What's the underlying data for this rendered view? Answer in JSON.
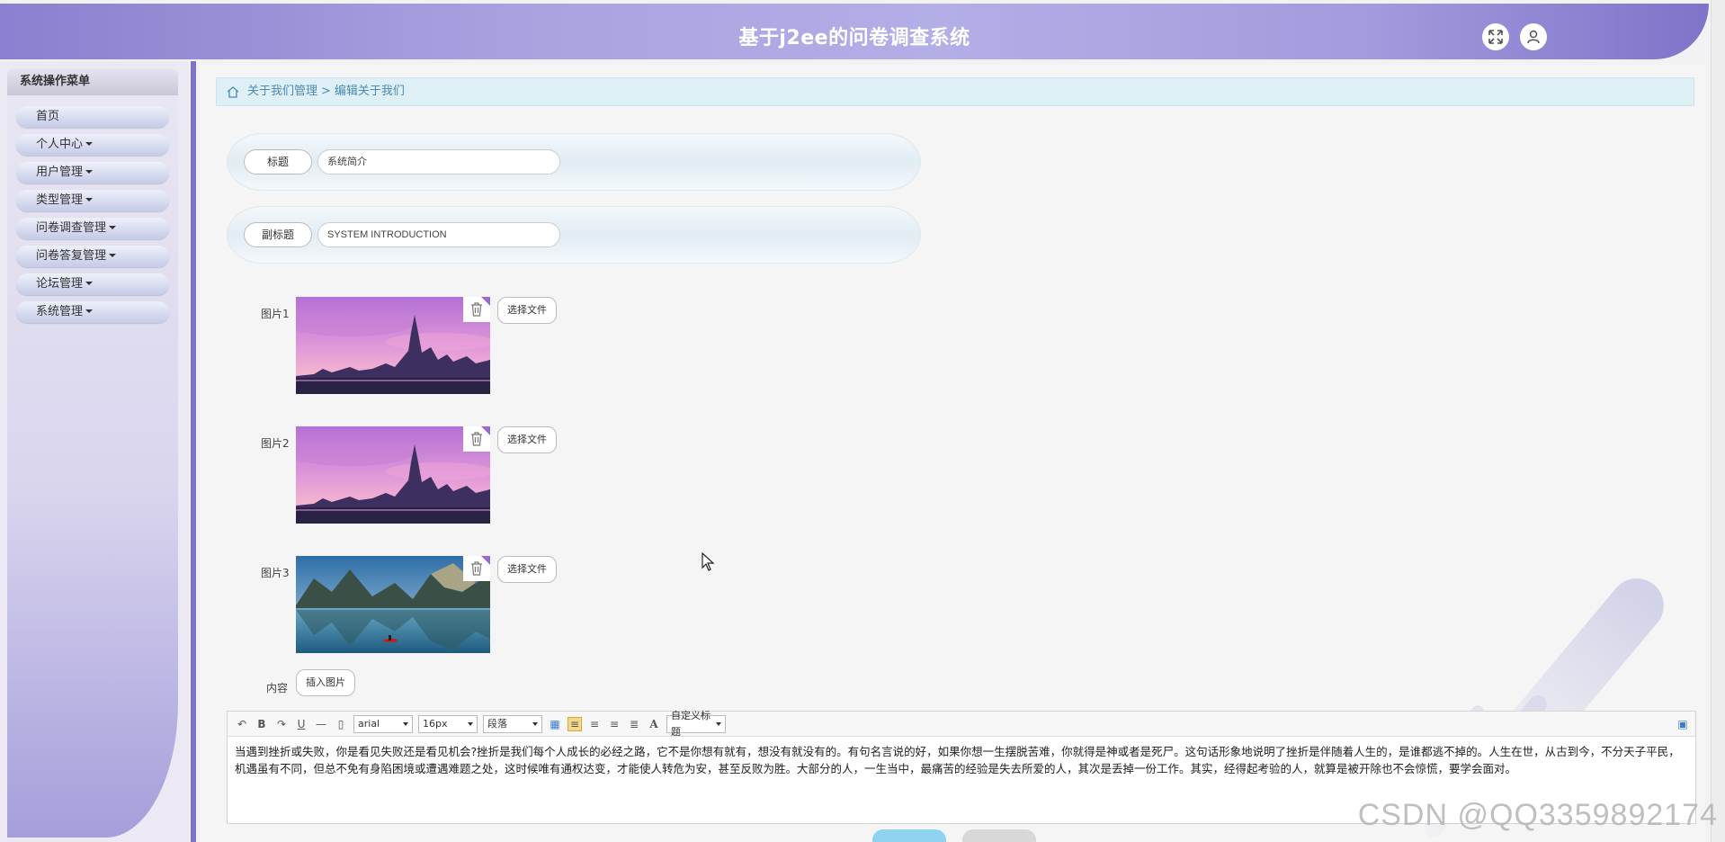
{
  "header": {
    "title": "基于j2ee的问卷调查系统"
  },
  "sidebar": {
    "title": "系统操作菜单",
    "items": [
      {
        "label": "首页",
        "has_caret": false
      },
      {
        "label": "个人中心",
        "has_caret": true
      },
      {
        "label": "用户管理",
        "has_caret": true
      },
      {
        "label": "类型管理",
        "has_caret": true
      },
      {
        "label": "问卷调查管理",
        "has_caret": true
      },
      {
        "label": "问卷答复管理",
        "has_caret": true
      },
      {
        "label": "论坛管理",
        "has_caret": true
      },
      {
        "label": "系统管理",
        "has_caret": true
      }
    ]
  },
  "breadcrumb": {
    "parent": "关于我们管理",
    "separator": ">",
    "current": "编辑关于我们"
  },
  "form": {
    "title_label": "标题",
    "title_value": "系统简介",
    "subtitle_label": "副标题",
    "subtitle_value": "SYSTEM INTRODUCTION",
    "images": [
      {
        "label": "图片1",
        "button": "选择文件",
        "scene": "pink-city-skyline"
      },
      {
        "label": "图片2",
        "button": "选择文件",
        "scene": "pink-city-skyline"
      },
      {
        "label": "图片3",
        "button": "选择文件",
        "scene": "mountain-lake-kayak"
      }
    ],
    "content_label": "内容",
    "insert_image_button": "插入图片"
  },
  "editor": {
    "font_family": "arial",
    "font_size": "16px",
    "paragraph": "段落",
    "custom_heading": "自定义标题",
    "content": "当遇到挫折或失败，你是看见失败还是看见机会?挫折是我们每个人成长的必经之路，它不是你想有就有，想没有就没有的。有句名言说的好，如果你想一生摆脱苦难，你就得是神或者是死尸。这句话形象地说明了挫折是伴随着人生的，是谁都逃不掉的。人生在世，从古到今，不分天子平民，机遇虽有不同，但总不免有身陷困境或遭遇难题之处，这时候唯有通权达变，才能使人转危为安，甚至反败为胜。大部分的人，一生当中，最痛苦的经验是失去所爱的人，其次是丢掉一份工作。其实，经得起考验的人，就算是被开除也不会惊慌，要学会面对。"
  },
  "watermark": "CSDN @QQ3359892174",
  "colors": {
    "header_accent": "#a8a2e0",
    "sidebar_accent": "#7d74c6",
    "breadcrumb_bg": "#dfeff6",
    "link": "#4a8ab3"
  }
}
